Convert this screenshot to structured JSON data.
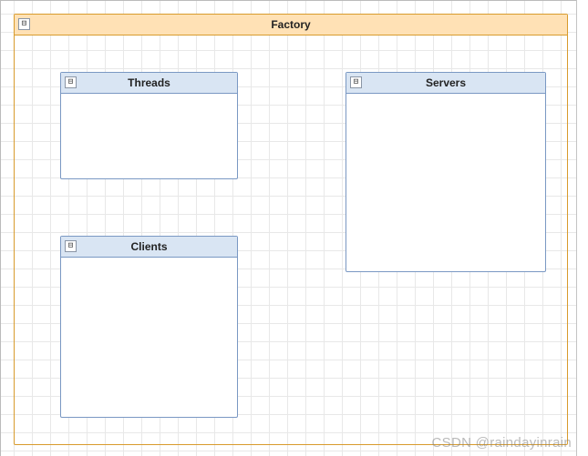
{
  "factory": {
    "title": "Factory",
    "collapse_glyph": "⊟"
  },
  "boxes": {
    "threads": {
      "title": "Threads",
      "collapse_glyph": "⊟"
    },
    "servers": {
      "title": "Servers",
      "collapse_glyph": "⊟"
    },
    "clients": {
      "title": "Clients",
      "collapse_glyph": "⊟"
    }
  },
  "watermark": "CSDN @raindayinrain"
}
